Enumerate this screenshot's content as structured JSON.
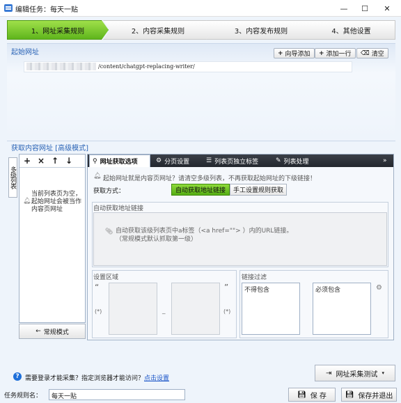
{
  "window": {
    "title": "编辑任务：每天一贴",
    "controls": {
      "minimize": "—",
      "maximize": "☐",
      "close": "✕"
    }
  },
  "steps": [
    {
      "label": "1、网址采集规则",
      "state": "active"
    },
    {
      "label": "2、内容采集规则",
      "state": "inactive"
    },
    {
      "label": "3、内容发布规则",
      "state": "inactive"
    },
    {
      "label": "4、其他设置",
      "state": "inactive"
    }
  ],
  "start_url": {
    "section_label": "起始网址",
    "buttons": {
      "wizard": "向导添加",
      "add_row": "添加一行",
      "clear": "清空"
    },
    "url_value": "/content/chatgpt-replacing-writer/"
  },
  "content_url": {
    "section_label": "获取内容网址 [高级模式]",
    "vertical_tab": "多级列表",
    "empty_hint": "当前列表页为空，起始网址会被当作内容页网址",
    "normal_mode_button": "常规模式",
    "tabs": [
      {
        "label": "网址获取选项",
        "icon": "link-icon"
      },
      {
        "label": "分页设置",
        "icon": "cog-icon"
      },
      {
        "label": "列表页独立标签",
        "icon": "list-icon"
      },
      {
        "label": "列表处理",
        "icon": "pencil-icon"
      }
    ],
    "options": {
      "notice": "起始网址就是内容页网址？请清空多级列表，不再获取起始网址的下级链接！",
      "get_method_label": "获取方式：",
      "auto_button": "自动获取地址链接",
      "manual_button": "手工设置规则获取",
      "auto_group_title": "自动获取地址链接",
      "auto_desc_line1": "自动获取该级列表页中a标签（<a href=\"\"> ）内的URL链接。",
      "auto_desc_line2": "（常规模式默认抓取第一级）",
      "region_group_title": "设置区域",
      "quote_open": "“",
      "quote_close": "”",
      "wildcard": "(*)",
      "dash": "_",
      "filter_group_title": "链接过滤",
      "must_not_contain": "不得包含",
      "must_contain": "必须包含"
    }
  },
  "bottom": {
    "login_text": "需要登录才能采集？指定浏览器才能访问？",
    "login_link": "点击设置",
    "test_button": "网址采集测试",
    "task_name_label": "任务规则名：",
    "task_name_value": "每天一贴",
    "save_button": "保 存",
    "save_exit_button": "保存并退出"
  },
  "colors": {
    "accent_green": "#5fb51c",
    "section_blue": "#2b64b6",
    "link_blue": "#1a55c8",
    "tab_bar_dark": "#2a2e35"
  }
}
